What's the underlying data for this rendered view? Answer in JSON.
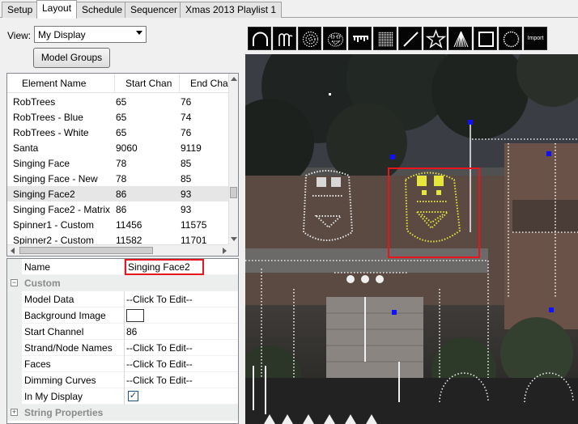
{
  "tabs": [
    {
      "label": "Setup"
    },
    {
      "label": "Layout"
    },
    {
      "label": "Schedule"
    },
    {
      "label": "Sequencer"
    },
    {
      "label": "Xmas 2013 Playlist 1"
    }
  ],
  "view": {
    "label": "View:",
    "selected": "My Display"
  },
  "model_groups_button": "Model Groups",
  "elements": {
    "columns": [
      "Element Name",
      "Start Chan",
      "End Cha"
    ],
    "rows": [
      [
        "RobTrees",
        "65",
        "76"
      ],
      [
        "RobTrees - Blue",
        "65",
        "74"
      ],
      [
        "RobTrees - White",
        "65",
        "76"
      ],
      [
        "Santa",
        "9060",
        "9119"
      ],
      [
        "Singing Face",
        "78",
        "85"
      ],
      [
        "Singing Face - New",
        "78",
        "85"
      ],
      [
        "Singing Face2",
        "86",
        "93"
      ],
      [
        "Singing Face2 - Matrix",
        "86",
        "93"
      ],
      [
        "Spinner1 - Custom",
        "11456",
        "11575"
      ],
      [
        "Spinner2 - Custom",
        "11582",
        "11701"
      ]
    ],
    "selected_index": 6
  },
  "properties": {
    "name_label": "Name",
    "name_value": "Singing Face2",
    "custom_category": "Custom",
    "rows": [
      {
        "label": "Model Data",
        "value": "--Click To Edit--"
      },
      {
        "label": "Background Image",
        "value": ""
      },
      {
        "label": "Start Channel",
        "value": "86"
      },
      {
        "label": "Strand/Node Names",
        "value": "--Click To Edit--"
      },
      {
        "label": "Faces",
        "value": "--Click To Edit--"
      },
      {
        "label": "Dimming Curves",
        "value": "--Click To Edit--"
      },
      {
        "label": "In My Display",
        "value": "✓"
      }
    ],
    "string_category": "String Properties"
  },
  "toolbar": {
    "icons": [
      "arch-icon",
      "candy-cane-icon",
      "star-circle-icon",
      "singing-face-icon",
      "icicles-icon",
      "matrix-icon",
      "single-line-icon",
      "star-icon",
      "tree-icon",
      "window-frame-icon",
      "circle-icon",
      "import-icon"
    ],
    "import_label": "Import"
  },
  "colors": {
    "selection_red": "#e8141e",
    "face_selected": "#e6e63c",
    "face_normal": "#e8e8e8",
    "handle_blue": "#1010ff"
  }
}
